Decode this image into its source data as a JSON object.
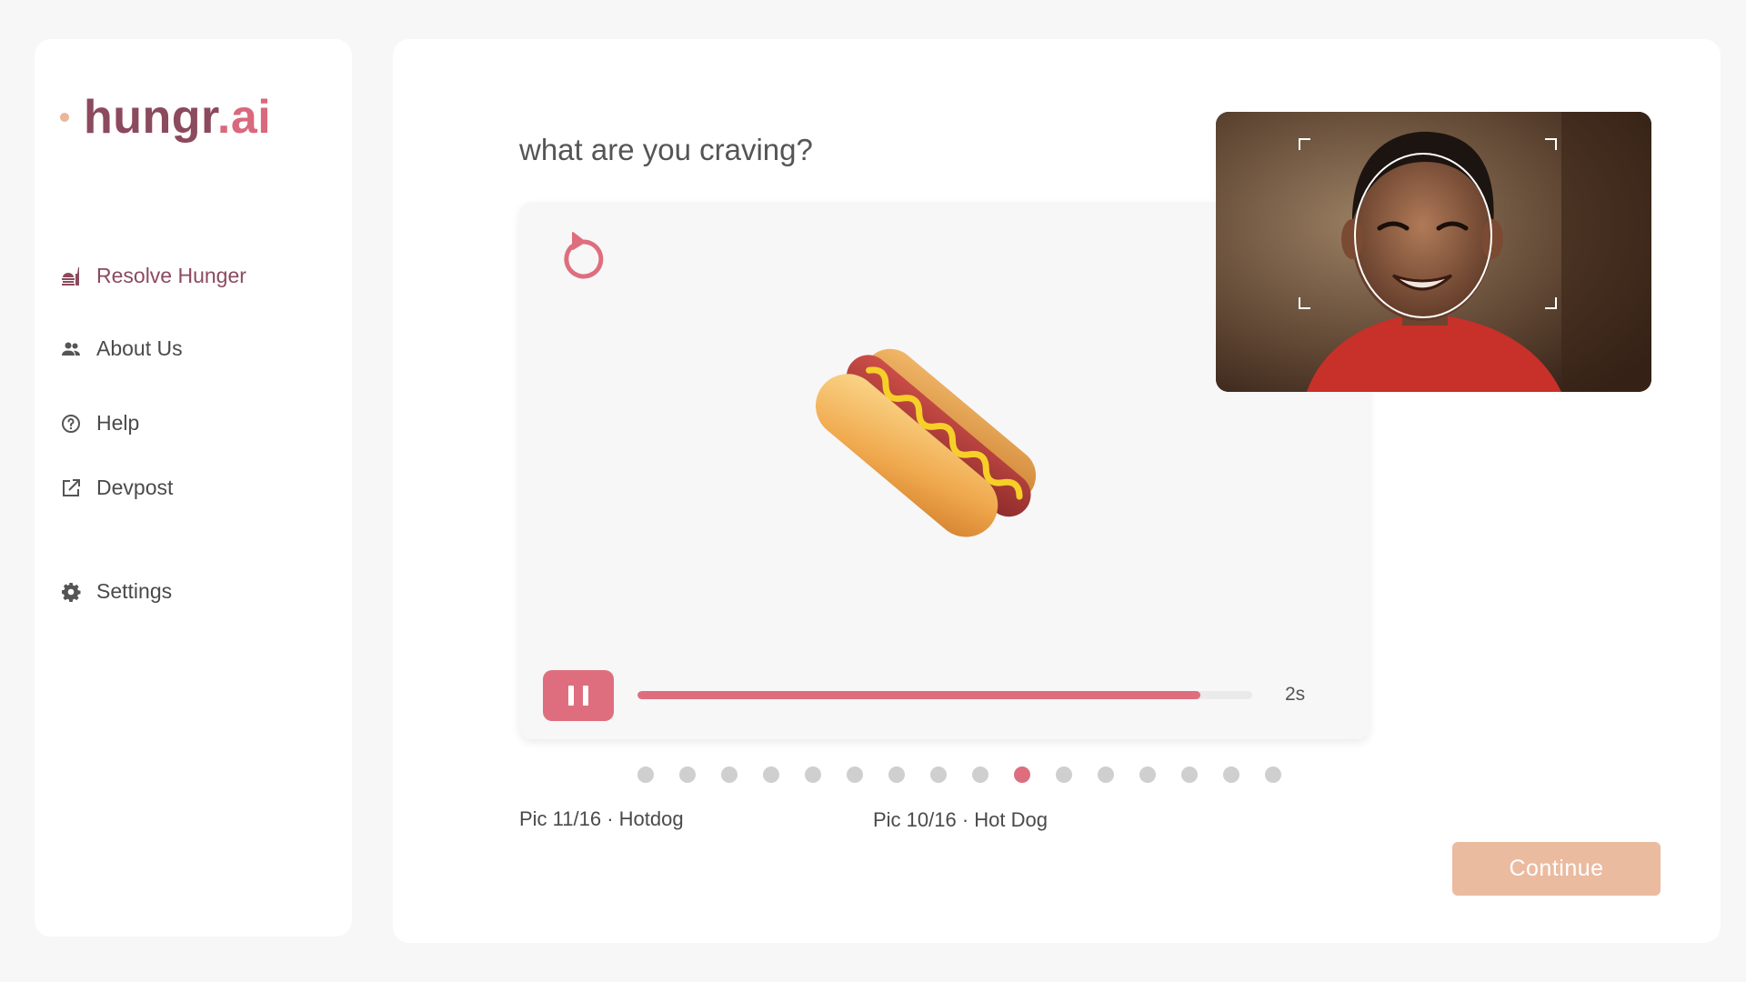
{
  "brand": {
    "name_main": "hungr",
    "name_suffix": ".ai"
  },
  "sidebar": {
    "items": [
      {
        "label": "Resolve Hunger",
        "icon": "food-icon",
        "active": true
      },
      {
        "label": "About Us",
        "icon": "people-icon",
        "active": false
      },
      {
        "label": "Help",
        "icon": "help-circle-icon",
        "active": false
      },
      {
        "label": "Devpost",
        "icon": "external-link-icon",
        "active": false
      },
      {
        "label": "Settings",
        "icon": "gear-icon",
        "active": false
      }
    ]
  },
  "main": {
    "question": "what are you craving?",
    "current_image": "hotdog-emoji",
    "timer": {
      "label": "2s",
      "progress": 0.915
    },
    "carousel": {
      "total": 16,
      "active_index": 9
    },
    "caption_left": "Pic 11/16 · Hotdog",
    "caption_right": "Pic 10/16 · Hot Dog",
    "continue_label": "Continue"
  },
  "colors": {
    "accent": "#de6e7e",
    "brand_dark": "#8c4a5e",
    "brand_light": "#d9697c",
    "continue_bg": "#ebbba0",
    "dot_inactive": "#cfcfcf"
  }
}
